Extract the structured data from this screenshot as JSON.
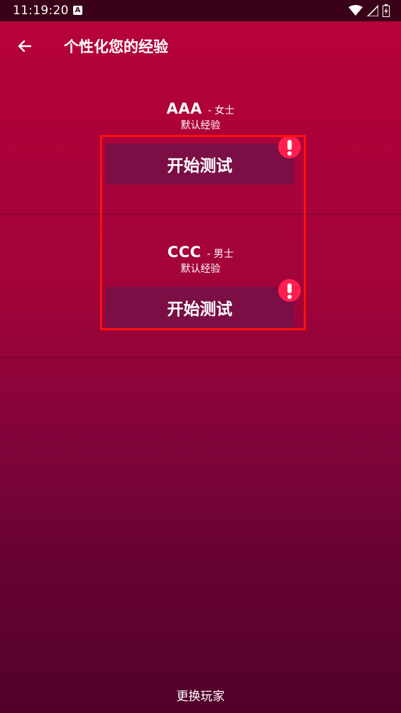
{
  "status_bar": {
    "time": "11:19:20",
    "notification_icon": "A",
    "icons": [
      "wifi-icon",
      "signal-icon",
      "battery-icon"
    ]
  },
  "app_bar": {
    "back_icon": "arrow-left-icon",
    "title": "个性化您的经验"
  },
  "players": [
    {
      "name": "AAA",
      "gender": "- 女士",
      "experience": "默认经验",
      "button_label": "开始测试",
      "badge_icon": "exclamation-icon"
    },
    {
      "name": "CCC",
      "gender": "- 男士",
      "experience": "默认经验",
      "button_label": "开始测试",
      "badge_icon": "exclamation-icon"
    }
  ],
  "footer": {
    "change_player_label": "更换玩家"
  },
  "colors": {
    "status_bar": "#3a0218",
    "background_top": "#b9023a",
    "background_bottom": "#52012c",
    "button": "#7a0e45",
    "alert_badge": "#ff1f4f",
    "highlight": "#ff1010"
  }
}
